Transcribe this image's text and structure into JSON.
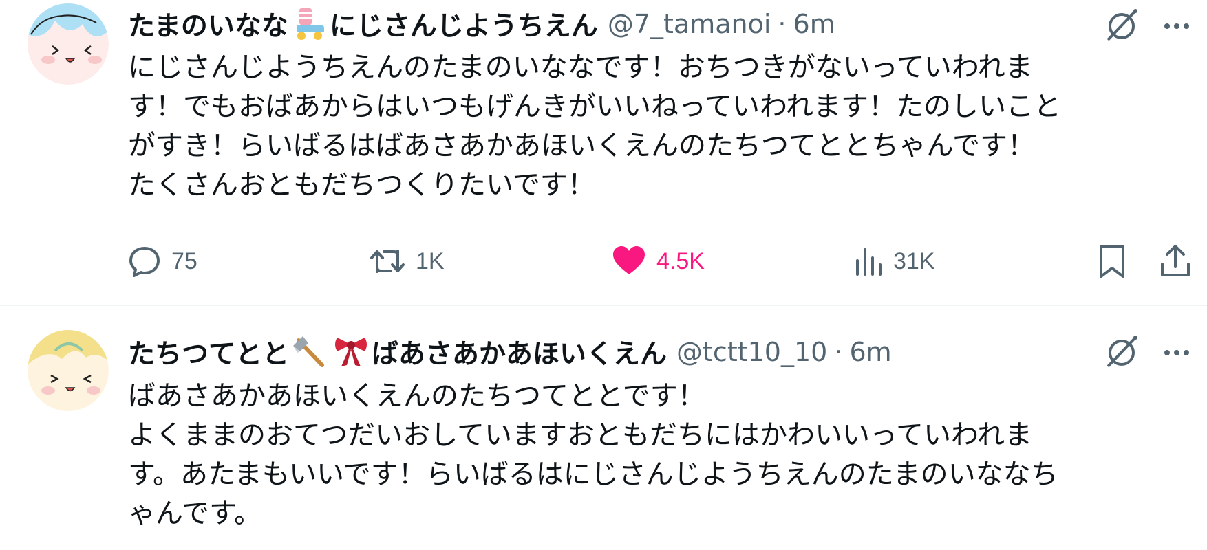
{
  "tweets": [
    {
      "display_name_a": "たまのいなな",
      "emoji": "roller-skate",
      "display_name_b": "にじさんじようちえん",
      "handle": "@7_tamanoi",
      "separator": "·",
      "time": "6m",
      "lines": [
        "にじさんじようちえんのたまのいななです！おちつきがないっていわれま",
        "す！でもおばあからはいつもげんきがいいねっていわれます！たのしいこと",
        "がすき！らいばるはばあさあかあほいくえんのたちつてととちゃんです！",
        "たくさんおともだちつくりたいです！"
      ],
      "replies": "75",
      "reposts": "1K",
      "likes": "4.5K",
      "views": "31K",
      "liked": true
    },
    {
      "display_name_a": "たちつてとと",
      "emojis": [
        "axe",
        "ribbon"
      ],
      "display_name_b": "ばあさあかあほいくえん",
      "handle": "@tctt10_10",
      "separator": "·",
      "time": "6m",
      "lines": [
        "ばあさあかあほいくえんのたちつてととです！",
        "よくままのおてつだいおしていますおともだちにはかわいいっていわれま",
        "す。あたまもいいです！らいばるはにじさんじようちえんのたまのいななち",
        "ゃんです。"
      ]
    }
  ],
  "colors": {
    "text": "#0f1419",
    "secondary": "#536471",
    "like": "#f91880",
    "divider": "#eff3f4"
  },
  "icons": {
    "grok": "grok-icon",
    "more": "more-icon",
    "reply": "reply-icon",
    "repost": "repost-icon",
    "like": "heart-icon",
    "views": "views-icon",
    "bookmark": "bookmark-icon",
    "share": "share-icon"
  }
}
